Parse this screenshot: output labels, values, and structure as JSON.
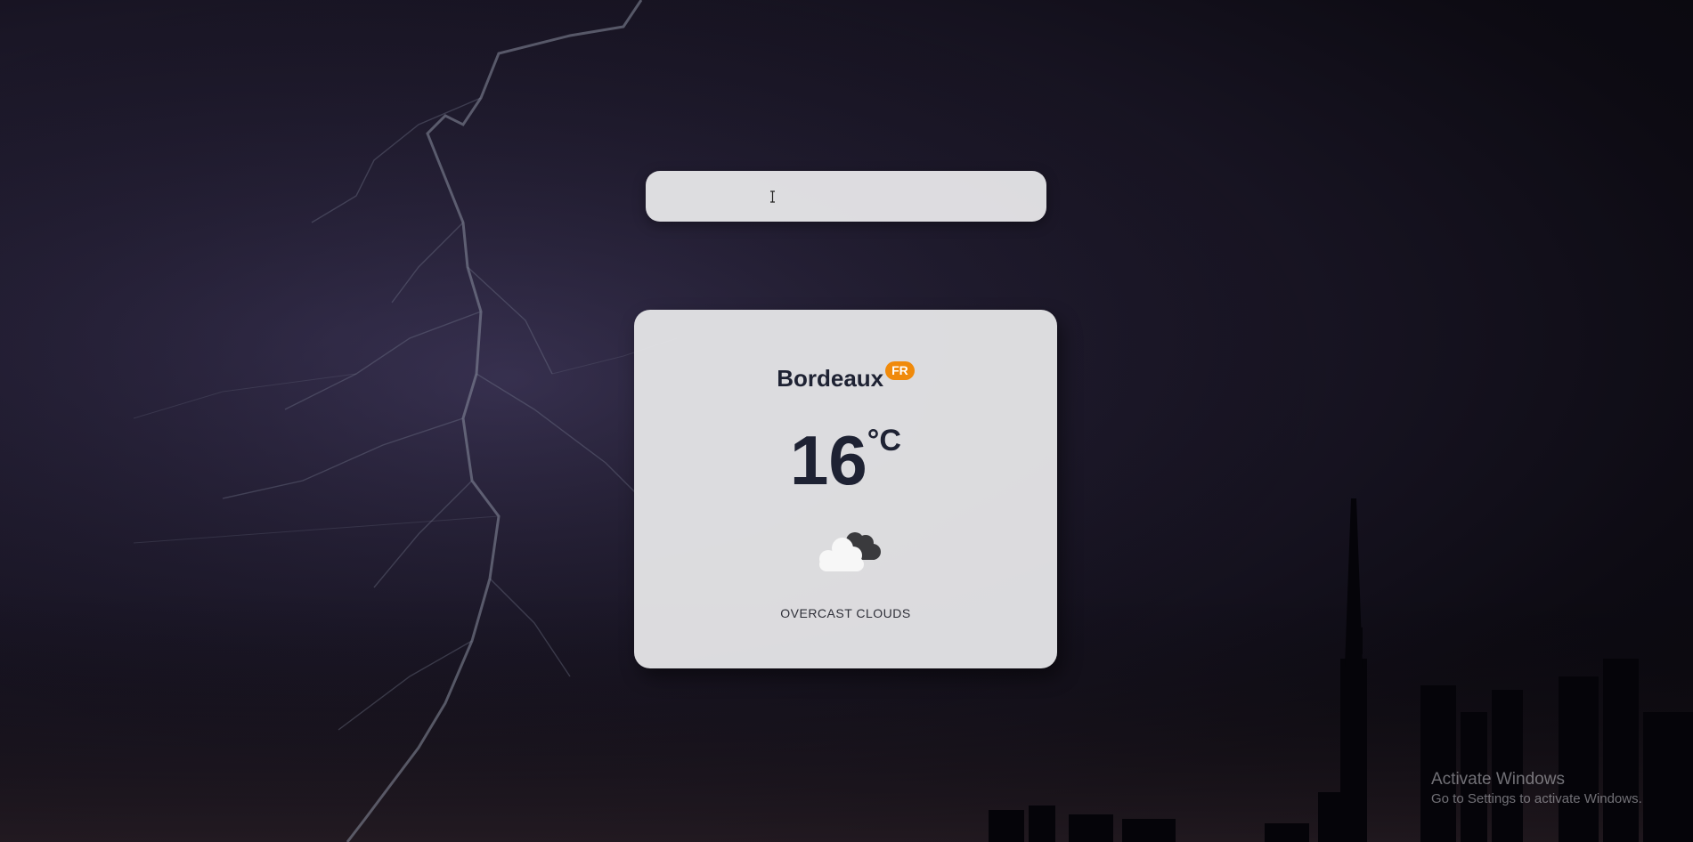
{
  "search": {
    "value": "",
    "placeholder": ""
  },
  "weather": {
    "city": "Bordeaux",
    "country": "FR",
    "temperature": "16",
    "unit": "°C",
    "condition": "OVERCAST CLOUDS",
    "icon": "overcast-clouds-icon"
  },
  "watermark": {
    "title": "Activate Windows",
    "subtitle": "Go to Settings to activate Windows."
  },
  "colors": {
    "badge": "#f08a0b",
    "text_dark": "#1e2233",
    "card_bg": "#e4e4e6"
  }
}
